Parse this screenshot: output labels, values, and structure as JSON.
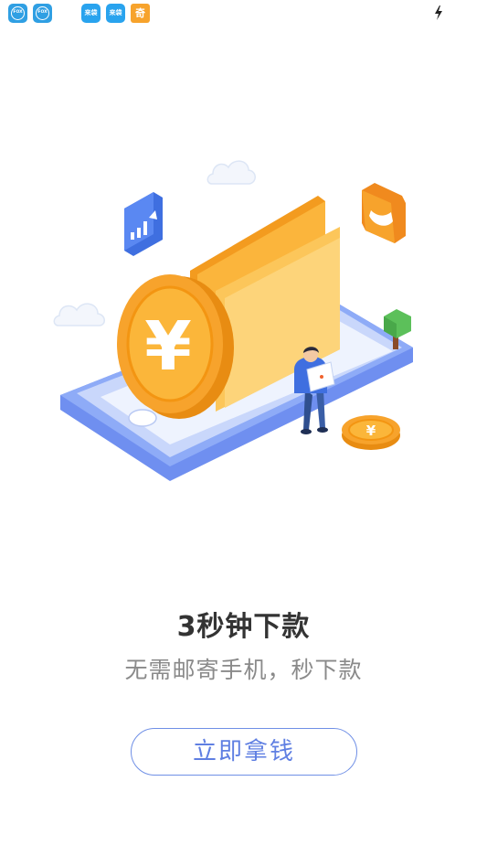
{
  "status_bar": {
    "apps": [
      {
        "name": "fox-app",
        "label": "FOX"
      },
      {
        "name": "fox-app",
        "label": "FOX"
      },
      {
        "name": "laidai-app",
        "label": "来袋"
      },
      {
        "name": "laidai-app",
        "label": "来袋"
      },
      {
        "name": "qi-app",
        "label": "奇"
      }
    ],
    "charging_icon": "lightning-bolt"
  },
  "illustration": {
    "coin_symbol": "¥"
  },
  "main": {
    "title": "3秒钟下款",
    "subtitle": "无需邮寄手机，秒下款",
    "cta_label": "立即拿钱"
  },
  "colors": {
    "accent": "#5f7fe2",
    "coin": "#f7a32c",
    "phone": "#7f9ff0"
  }
}
